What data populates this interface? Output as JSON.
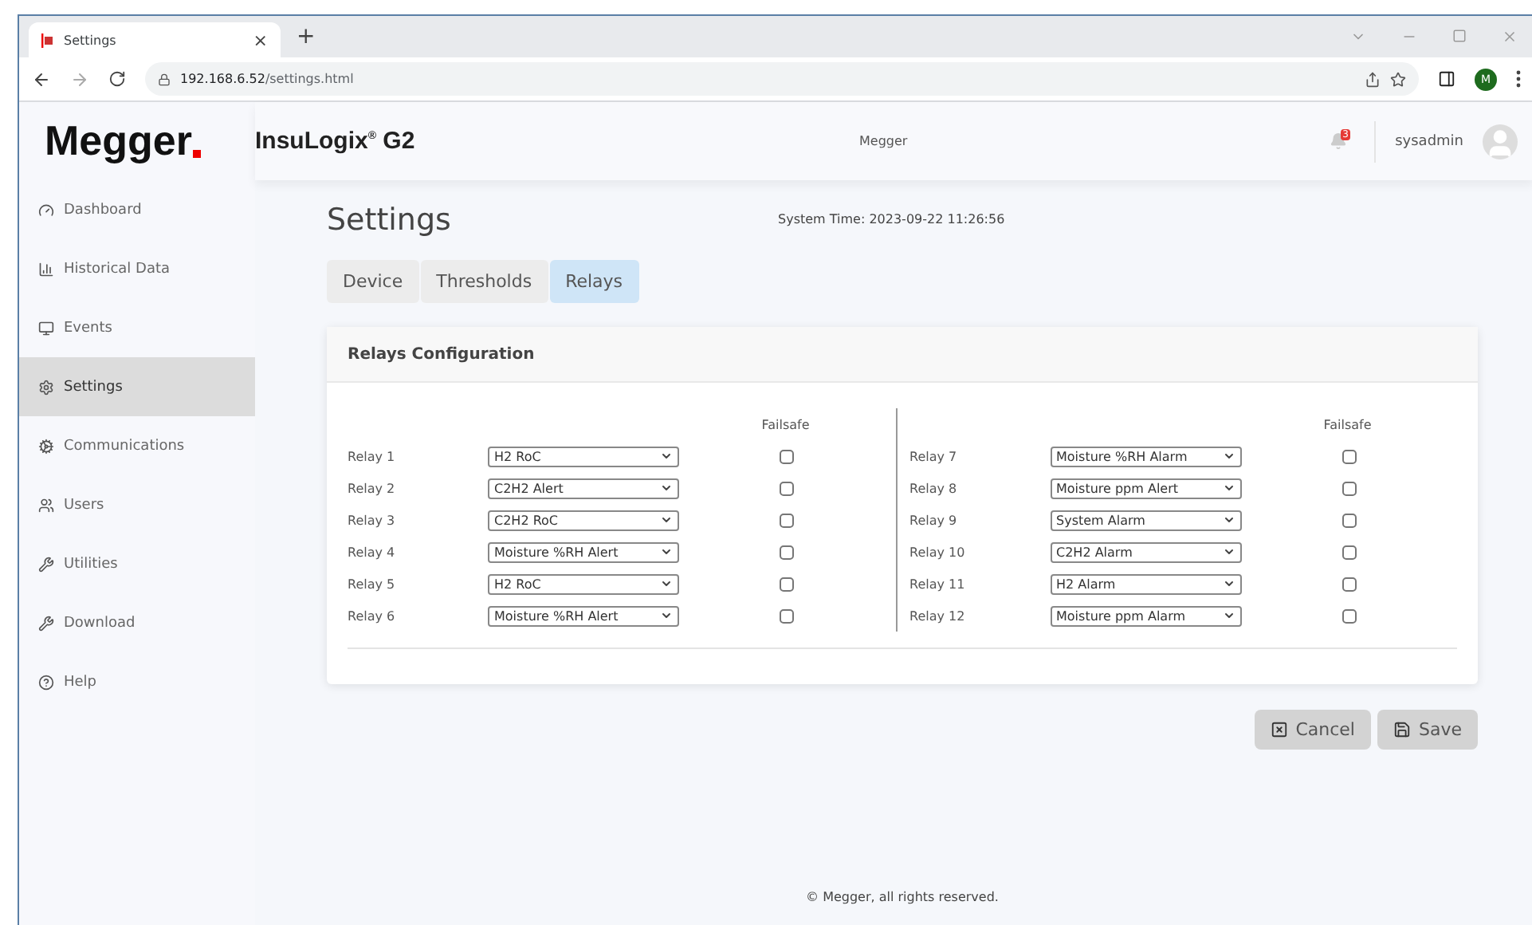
{
  "browser": {
    "tab_title": "Settings",
    "tab_close": "×",
    "new_tab": "+",
    "url_host": "192.168.6.52",
    "url_path": "/settings.html",
    "profile": "M"
  },
  "header": {
    "logo": "Megger",
    "product": "InsuLogix$^{®}$ G2",
    "site": "Megger",
    "notifications": "3",
    "user": "sysadmin"
  },
  "sidebar": {
    "items": [
      {
        "label": "Dashboard",
        "selected": false
      },
      {
        "label": "Historical Data",
        "selected": false
      },
      {
        "label": "Events",
        "selected": false
      },
      {
        "label": "Settings",
        "selected": true
      },
      {
        "label": "Communications",
        "selected": false
      },
      {
        "label": "Users",
        "selected": false
      },
      {
        "label": "Utilities",
        "selected": false
      },
      {
        "label": "Download",
        "selected": false
      },
      {
        "label": "Help",
        "selected": false
      }
    ]
  },
  "page": {
    "title": "Settings",
    "system_time": "System Time: 2023-09-22 11:26:56"
  },
  "tabs": [
    {
      "label": "Device",
      "selected": false
    },
    {
      "label": "Thresholds",
      "selected": false
    },
    {
      "label": "Relays",
      "selected": true
    }
  ],
  "card": {
    "title": "Relays Configuration",
    "groups": [
      {
        "failsafe_header": "Failsafe",
        "relays": [
          {
            "label": "Relay 1",
            "value": "H2 RoC",
            "failsafe": false
          },
          {
            "label": "Relay 2",
            "value": "C2H2 Alert",
            "failsafe": false
          },
          {
            "label": "Relay 3",
            "value": "C2H2 RoC",
            "failsafe": false
          },
          {
            "label": "Relay 4",
            "value": "Moisture %RH Alert",
            "failsafe": false
          },
          {
            "label": "Relay 5",
            "value": "H2 RoC",
            "failsafe": false
          },
          {
            "label": "Relay 6",
            "value": "Moisture %RH Alert",
            "failsafe": false
          }
        ]
      },
      {
        "failsafe_header": "Failsafe",
        "relays": [
          {
            "label": "Relay 7",
            "value": "Moisture %RH Alarm",
            "failsafe": false
          },
          {
            "label": "Relay 8",
            "value": "Moisture ppm Alert",
            "failsafe": false
          },
          {
            "label": "Relay 9",
            "value": "System Alarm",
            "failsafe": false
          },
          {
            "label": "Relay 10",
            "value": "C2H2 Alarm",
            "failsafe": false
          },
          {
            "label": "Relay 11",
            "value": "H2 Alarm",
            "failsafe": false
          },
          {
            "label": "Relay 12",
            "value": "Moisture ppm Alarm",
            "failsafe": false
          }
        ]
      }
    ]
  },
  "buttons": [
    {
      "label": "Cancel",
      "kind": "cancel"
    },
    {
      "label": "Save",
      "kind": "save"
    }
  ],
  "footer": "© Megger, all rights reserved."
}
